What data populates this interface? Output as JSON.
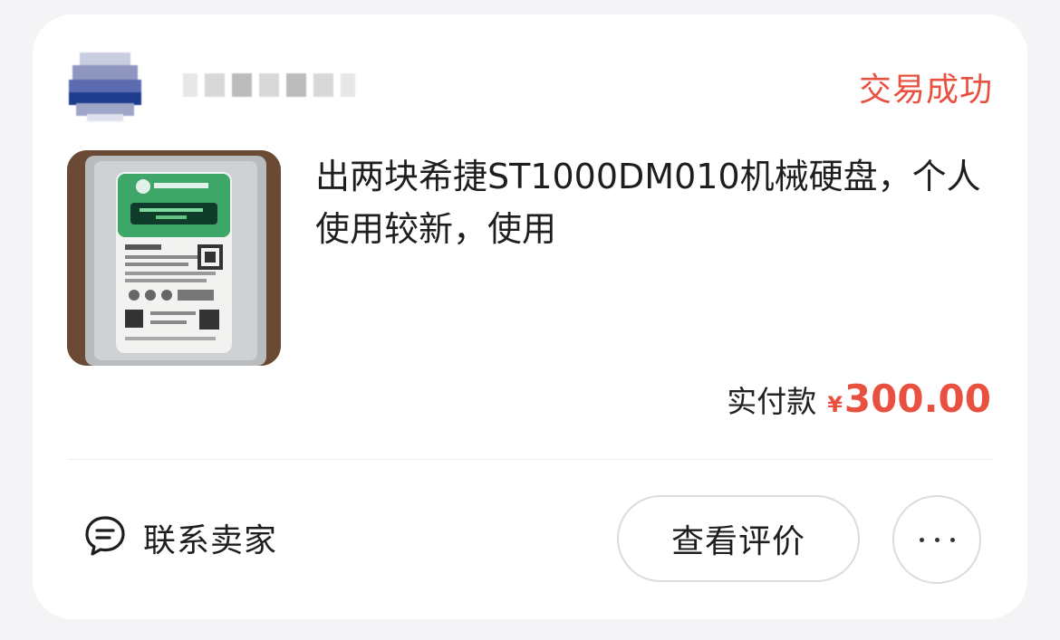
{
  "order": {
    "seller_name_masked": "▇▇▇▇▇",
    "status": "交易成功",
    "item_title": "出两块希捷ST1000DM010机械硬盘，个人使用较新，使用",
    "payment_label": "实付款",
    "currency_symbol": "¥",
    "payment_amount": "300.00"
  },
  "actions": {
    "contact_seller": "联系卖家",
    "view_review": "查看评价",
    "more_icon": "ellipsis-icon"
  },
  "colors": {
    "accent": "#e8503f",
    "text": "#1e1e1e",
    "border": "#dcdcdc"
  }
}
